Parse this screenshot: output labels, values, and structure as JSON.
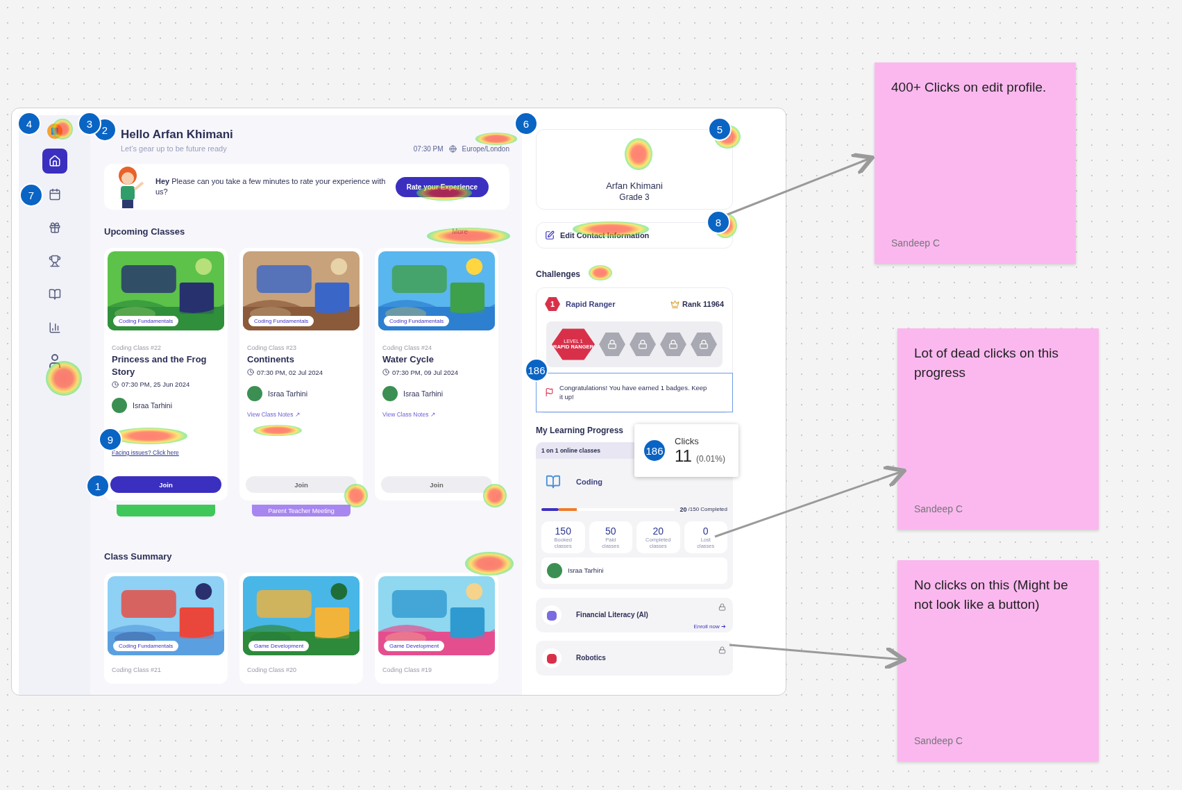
{
  "notes": [
    {
      "text": "400+ Clicks on edit profile.",
      "author": "Sandeep C"
    },
    {
      "text": "Lot of dead clicks on this progress",
      "author": "Sandeep C"
    },
    {
      "text": "No clicks on this (Might be not look like a button)",
      "author": "Sandeep C"
    }
  ],
  "sidebar": {
    "items": [
      {
        "kind": "logo",
        "selected": false
      },
      {
        "kind": "home",
        "selected": true
      },
      {
        "kind": "calendar",
        "selected": false
      },
      {
        "kind": "gift",
        "selected": false
      },
      {
        "kind": "trophy",
        "selected": false
      },
      {
        "kind": "book",
        "selected": false
      },
      {
        "kind": "chart",
        "selected": false
      },
      {
        "kind": "user",
        "selected": false
      }
    ]
  },
  "header": {
    "greeting": "Hello Arfan Khimani",
    "subtitle": "Let’s gear up to be future ready",
    "time": "07:30 PM",
    "timezone": "Europe/London"
  },
  "banner": {
    "lead": "Hey",
    "message": "Please can you take a few minutes to rate your experience with us?",
    "button": "Rate your Experience"
  },
  "upcoming": {
    "title": "Upcoming Classes",
    "more": "More",
    "cards": [
      {
        "tag": "Coding Fundamentals",
        "number": "Coding Class #22",
        "title": "Princess and the Frog Story",
        "time": "07:30 PM, 25 Jun 2024",
        "teacher": "Israa Tarhini",
        "link": {
          "kind": "issue",
          "label": "Facing issues? Click here"
        },
        "join": "Join",
        "join_active": true,
        "extra": {
          "kind": "session"
        }
      },
      {
        "tag": "Coding Fundamentals",
        "number": "Coding Class #23",
        "title": "Continents",
        "time": "07:30 PM, 02 Jul 2024",
        "teacher": "Israa Tarhini",
        "link": {
          "kind": "notes",
          "label": "View Class Notes ↗"
        },
        "join": "Join",
        "join_active": false,
        "extra": {
          "kind": "meeting",
          "label": "Parent Teacher Meeting"
        }
      },
      {
        "tag": "Coding Fundamentals",
        "number": "Coding Class #24",
        "title": "Water Cycle",
        "time": "07:30 PM, 09 Jul 2024",
        "teacher": "Israa Tarhini",
        "link": {
          "kind": "notes",
          "label": "View Class Notes ↗"
        },
        "join": "Join",
        "join_active": false
      }
    ]
  },
  "summary": {
    "title": "Class Summary",
    "cards": [
      {
        "tag": "Coding Fundamentals",
        "number": "Coding Class #21"
      },
      {
        "tag": "Game Development",
        "number": "Coding Class #20"
      },
      {
        "tag": "Game Development",
        "number": "Coding Class #19"
      }
    ]
  },
  "profile": {
    "name": "Arfan Khimani",
    "grade": "Grade 3",
    "edit": "Edit Contact Information"
  },
  "challenges": {
    "title": "Challenges",
    "name": "Rapid Ranger",
    "level": "1",
    "rank": "Rank 11964",
    "badge_level": "LEVEL 1",
    "badge_name": "RAPID RANGER",
    "badges": [
      {
        "earned": true
      },
      {
        "earned": false
      },
      {
        "earned": false
      },
      {
        "earned": false
      },
      {
        "earned": false
      }
    ],
    "message": "Congratulations! You have earned 1 badges. Keep it up!"
  },
  "learning": {
    "title": "My Learning Progress",
    "tab": "1 on 1 online classes",
    "subject": "Coding",
    "level": 0.133,
    "done": "20",
    "total": "/150 Completed",
    "stats": [
      {
        "value": "150",
        "label": "Booked classes"
      },
      {
        "value": "50",
        "label": "Paid classes"
      },
      {
        "value": "20",
        "label": "Completed classes"
      },
      {
        "value": "0",
        "label": "Lost classes"
      }
    ],
    "teacher": "Israa Tarhini",
    "courses": [
      {
        "name": "Financial Literacy (AI)",
        "locked": true,
        "action": "Enroll now ➔"
      },
      {
        "name": "Robotics",
        "locked": true
      }
    ]
  },
  "markers": [
    {
      "label": "4"
    },
    {
      "label": "2"
    },
    {
      "label": "3"
    },
    {
      "label": "6"
    },
    {
      "label": "5"
    },
    {
      "label": "7"
    },
    {
      "label": "8"
    },
    {
      "label": "186"
    },
    {
      "label": "9"
    },
    {
      "label": "1"
    }
  ],
  "tooltip": {
    "badge": "186",
    "title": "Clicks",
    "value": "11",
    "share": "(0.01%)"
  }
}
